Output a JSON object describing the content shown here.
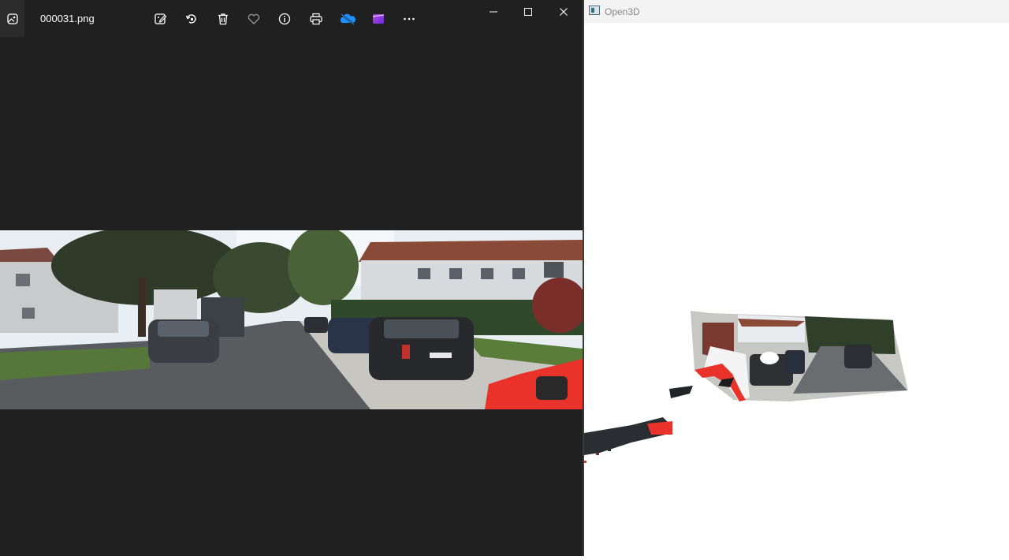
{
  "photos_window": {
    "file_name": "000031.png",
    "toolbar": [
      {
        "name": "edit-image-icon",
        "label": "Edit image"
      },
      {
        "name": "rotate-icon",
        "label": "Rotate"
      },
      {
        "name": "delete-icon",
        "label": "Delete"
      },
      {
        "name": "favorite-heart-icon",
        "label": "Add to favorites"
      },
      {
        "name": "file-info-icon",
        "label": "File information"
      },
      {
        "name": "print-icon",
        "label": "Print"
      },
      {
        "name": "onedrive-cloud-icon",
        "label": "OneDrive"
      },
      {
        "name": "clipchamp-icon",
        "label": "Clipchamp"
      },
      {
        "name": "more-options-icon",
        "label": "See more"
      }
    ],
    "window_controls": [
      "minimize",
      "maximize",
      "close"
    ]
  },
  "open3d_window": {
    "title": "Open3D"
  }
}
